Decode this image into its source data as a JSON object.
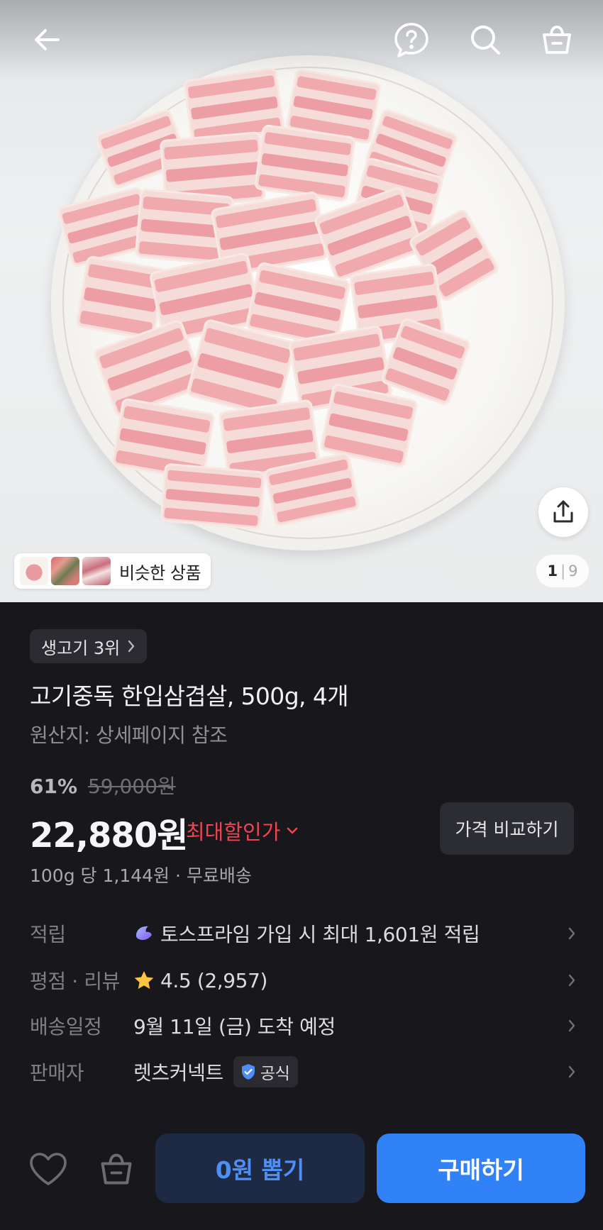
{
  "similar_products": {
    "label": "비슷한 상품"
  },
  "image_counter": {
    "current": "1",
    "separator": "|",
    "total": "9"
  },
  "rank_chip": {
    "label": "생고기 3위",
    "chevron": "›"
  },
  "product": {
    "title": "고기중독 한입삼겹살, 500g, 4개",
    "origin": "원산지: 상세페이지 참조",
    "discount_rate": "61%",
    "original_price": "59,000원",
    "price": "22,880원",
    "max_discount_label": "최대할인가",
    "compare_label": "가격 비교하기",
    "unit_price_shipping": "100g 당 1,144원 · 무료배송"
  },
  "info_rows": [
    {
      "label": "적립",
      "value": "토스프라임 가입 시 최대 1,601원 적립",
      "icon": "toss-prime-icon"
    },
    {
      "label": "평점 · 리뷰",
      "value": "4.5 (2,957)",
      "icon": "star-icon"
    },
    {
      "label": "배송일정",
      "value": "9월 11일 (금) 도착 예정"
    },
    {
      "label": "판매자",
      "value": "렛츠커넥트",
      "badge": "공식",
      "badge_icon": "shield-check-icon"
    }
  ],
  "bottom_bar": {
    "draw_label": "0원 뽑기",
    "buy_label": "구매하기"
  },
  "colors": {
    "background": "#17171c",
    "accent_blue": "#3182f6",
    "discount_red": "#f04452",
    "star_yellow": "#ffc342"
  }
}
